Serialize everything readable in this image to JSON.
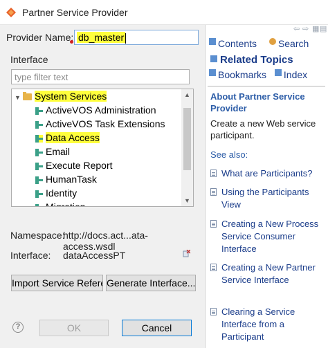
{
  "window": {
    "title": "Partner Service Provider"
  },
  "form": {
    "provider_label": "Provider Name:",
    "provider_value": "db_master",
    "interface_group_label": "Interface",
    "filter_placeholder": "type filter text",
    "tree": [
      {
        "label": "System Services",
        "type": "folder",
        "expanded": true,
        "highlighted": true
      },
      {
        "label": "ActiveVOS Administration",
        "type": "service"
      },
      {
        "label": "ActiveVOS Task Extensions",
        "type": "service"
      },
      {
        "label": "Data Access",
        "type": "service",
        "highlighted": true,
        "selected": true
      },
      {
        "label": "Email",
        "type": "service"
      },
      {
        "label": "Execute Report",
        "type": "service"
      },
      {
        "label": "HumanTask",
        "type": "service"
      },
      {
        "label": "Identity",
        "type": "service"
      },
      {
        "label": "Migration",
        "type": "service"
      }
    ],
    "namespace_label": "Namespace:",
    "namespace_value": "http://docs.act...ata-access.wsdl",
    "interface_label": "Interface:",
    "interface_value": "dataAccessPT",
    "import_button": "Import Service Reference...",
    "generate_button": "Generate Interface...",
    "ok_button": "OK",
    "cancel_button": "Cancel"
  },
  "help": {
    "contents": "Contents",
    "search": "Search",
    "related_topics": "Related Topics",
    "bookmarks": "Bookmarks",
    "index": "Index",
    "about_title": "About Partner Service Provider",
    "about_desc": "Create a new Web service participant.",
    "see_also": "See also:",
    "links": [
      "What are Participants?",
      "Using the Participants View",
      "Creating a New Process Service Consumer Interface",
      "Creating a New Partner Service Interface",
      "Clearing a Service Interface from a Participant"
    ]
  },
  "colors": {
    "highlight": "#ffff3c",
    "link": "#1a3c8a",
    "accent": "#2e5ea8"
  }
}
